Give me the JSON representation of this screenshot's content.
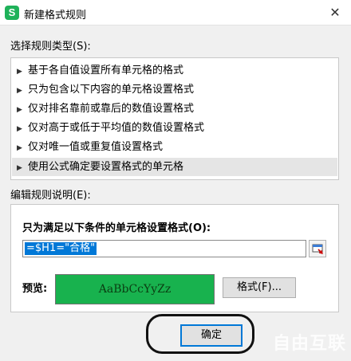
{
  "window": {
    "title": "新建格式规则",
    "app_icon_letter": "S",
    "close_symbol": "✕"
  },
  "rule_type": {
    "label": "选择规则类型(S):",
    "items": [
      "基于各自值设置所有单元格的格式",
      "只为包含以下内容的单元格设置格式",
      "仅对排名靠前或靠后的数值设置格式",
      "仅对高于或低于平均值的数值设置格式",
      "仅对唯一值或重复值设置格式",
      "使用公式确定要设置格式的单元格"
    ],
    "selected_index": 5
  },
  "rule_desc": {
    "label": "编辑规则说明(E):",
    "condition_label": "只为满足以下条件的单元格设置格式(O):",
    "formula_value": "=$H1=\"合格\"",
    "preview_label": "预览:",
    "preview_text": "AaBbCcYyZz",
    "preview_color": "#18b24e",
    "format_button": "格式(F)..."
  },
  "buttons": {
    "ok": "确定"
  },
  "watermark": "自由互联"
}
